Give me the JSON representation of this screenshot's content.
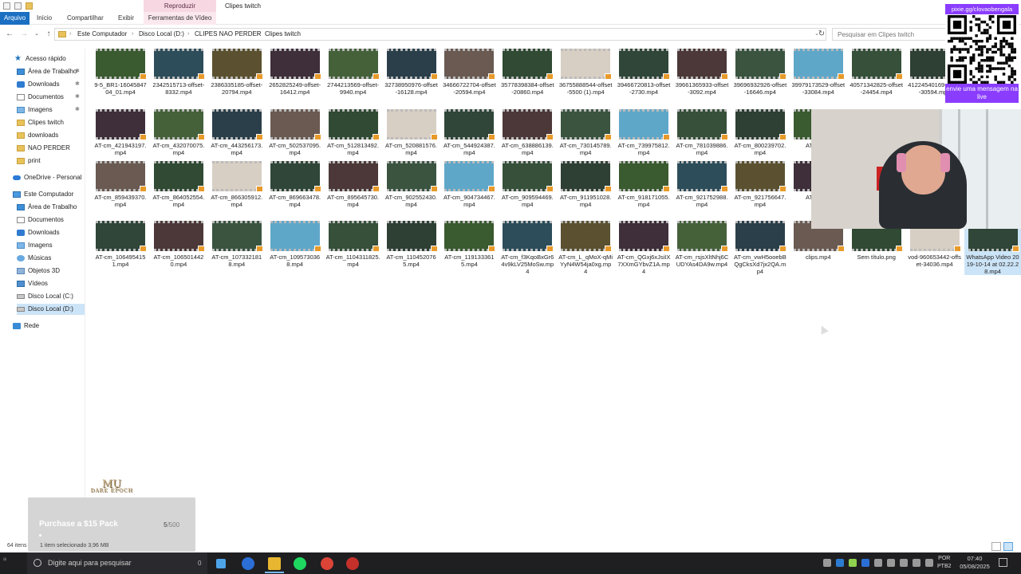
{
  "title_bar": {
    "tab_group": "Reproduzir",
    "window_title": "Clipes twitch"
  },
  "ribbon": {
    "tabs": [
      "Arquivo",
      "Início",
      "Compartilhar",
      "Exibir",
      "Ferramentas de Vídeo"
    ]
  },
  "address": {
    "crumbs": [
      "Este Computador",
      "Disco Local (D:)",
      "CLIPES NAO PERDER",
      "Clipes twitch"
    ],
    "search_placeholder": "Pesquisar em Clipes twitch"
  },
  "sidebar": {
    "items": [
      {
        "label": "Acesso rápido",
        "icon": "star-icon"
      },
      {
        "label": "Área de Trabalho",
        "icon": "desktop-folder-icon"
      },
      {
        "label": "Downloads",
        "icon": "download-folder-icon"
      },
      {
        "label": "Documentos",
        "icon": "documents-folder-icon"
      },
      {
        "label": "Imagens",
        "icon": "pictures-folder-icon"
      },
      {
        "label": "Clipes twitch",
        "icon": "folder-icon"
      },
      {
        "label": "downloads",
        "icon": "folder-icon"
      },
      {
        "label": "NAO PERDER",
        "icon": "folder-icon"
      },
      {
        "label": "print",
        "icon": "folder-icon"
      },
      {
        "label": "OneDrive - Personal",
        "icon": "cloud-icon"
      },
      {
        "label": "Este Computador",
        "icon": "computer-icon"
      },
      {
        "label": "Área de Trabalho",
        "icon": "desktop-folder-icon"
      },
      {
        "label": "Documentos",
        "icon": "documents-folder-icon"
      },
      {
        "label": "Downloads",
        "icon": "download-folder-icon"
      },
      {
        "label": "Imagens",
        "icon": "pictures-folder-icon"
      },
      {
        "label": "Músicas",
        "icon": "music-folder-icon"
      },
      {
        "label": "Objetos 3D",
        "icon": "3d-objects-icon"
      },
      {
        "label": "Vídeos",
        "icon": "videos-folder-icon"
      },
      {
        "label": "Disco Local (C:)",
        "icon": "drive-icon"
      },
      {
        "label": "Disco Local (D:)",
        "icon": "drive-icon"
      },
      {
        "label": "Rede",
        "icon": "network-icon"
      }
    ],
    "pin_glyph": "✱"
  },
  "files": {
    "row1": [
      "9-5_BR1-1604584704_01.mp4",
      "2342515713-offset-8332.mp4",
      "2386335185-offset-20794.mp4",
      "2652825249-offset-16412.mp4",
      "2744213569-offset-9940.mp4",
      "32738950976-offset-16128.mp4",
      "34666722704-offset-20594.mp4",
      "35778398384-offset-20860.mp4",
      "36755888544-offset-5500 (1).mp4",
      "39466720813-offset-2730.mp4",
      "39661365933-offset-3092.mp4",
      "39696932926-offset-16646.mp4",
      "39979173529-offset-33084.mp4",
      "40571342825-offset-24454.mp4",
      "41224540169-offset-30594.mp4"
    ],
    "row2": [
      "AT-cm_421943197.mp4",
      "AT-cm_432070075.mp4",
      "AT-cm_443256173.mp4",
      "AT-cm_502537095.mp4",
      "AT-cm_512813492.mp4",
      "AT-cm_520881576.mp4",
      "AT-cm_544924387.mp4",
      "AT-cm_638886139.mp4",
      "AT-cm_730145789.mp4",
      "AT-cm_739975812.mp4",
      "AT-cm_781039886.mp4",
      "AT-cm_800239702.mp4",
      "AT-cm_2."
    ],
    "row3": [
      "AT-cm_859439370.mp4",
      "AT-cm_864052554.mp4",
      "AT-cm_866305912.mp4",
      "AT-cm_869663478.mp4",
      "AT-cm_895645730.mp4",
      "AT-cm_902552430.mp4",
      "AT-cm_904734467.mp4",
      "AT-cm_909594469.mp4",
      "AT-cm_911951028.mp4",
      "AT-cm_918171055.mp4",
      "AT-cm_921752988.mp4",
      "AT-cm_921756647.mp4",
      "AT-cm_0."
    ],
    "row4": [
      "AT-cm_1064954151.mp4",
      "AT-cm_1065014420.mp4",
      "AT-cm_1073321818.mp4",
      "AT-cm_1095730368.mp4",
      "AT-cm_1104311825.mp4",
      "AT-cm_1104520765.mp4",
      "AT-cm_1191333615.mp4",
      "AT-cm_f3KqoBxGr64v9kLV25MoSw.mp4",
      "AT-cm_L_qMoX-qMiYyN4W54ja0xg.mp4",
      "AT-cm_QGxj6xJsiIX7XXmGYbvZ1A.mp4",
      "AT-cm_rsjsXltNhj6CUDYAs4DA9w.mp4",
      "AT-cm_vwH5ooebBQgCksXd7jx2QA.mp4",
      "clips.mp4",
      "Sem título.png",
      "vod-960653442-offset-34036.mp4",
      "WhatsApp Video 2019-10-14 at 02.22.28.mp4"
    ]
  },
  "thumb_colors": [
    "#3a5a2f",
    "#2d4d5a",
    "#5b5130",
    "#3e2f3a",
    "#45613a",
    "#2b3f4a",
    "#6a5a52",
    "#304a33",
    "#d8cfc4",
    "#2f4638",
    "#4c3838",
    "#3a5440",
    "#5fa7c9",
    "#36503a",
    "#2e3f33"
  ],
  "overlay": {
    "qr_link": "pixie.gg/clovaobengala",
    "qr_message": "envie uma mensagem na live"
  },
  "popup": {
    "title": "Purchase a $15 Pack",
    "count": "5",
    "total": "/500",
    "logo_line1": "MU",
    "logo_line2": "DARK EPOCH"
  },
  "status": {
    "count": "64 itens",
    "selection": "1 item selecionado  3,96 MB"
  },
  "taskbar": {
    "search_placeholder": "Digite aqui para pesquisar",
    "search_count": "0",
    "lang": "POR",
    "lang2": "PTB2",
    "time": "07:40",
    "date": "05/08/2025"
  }
}
